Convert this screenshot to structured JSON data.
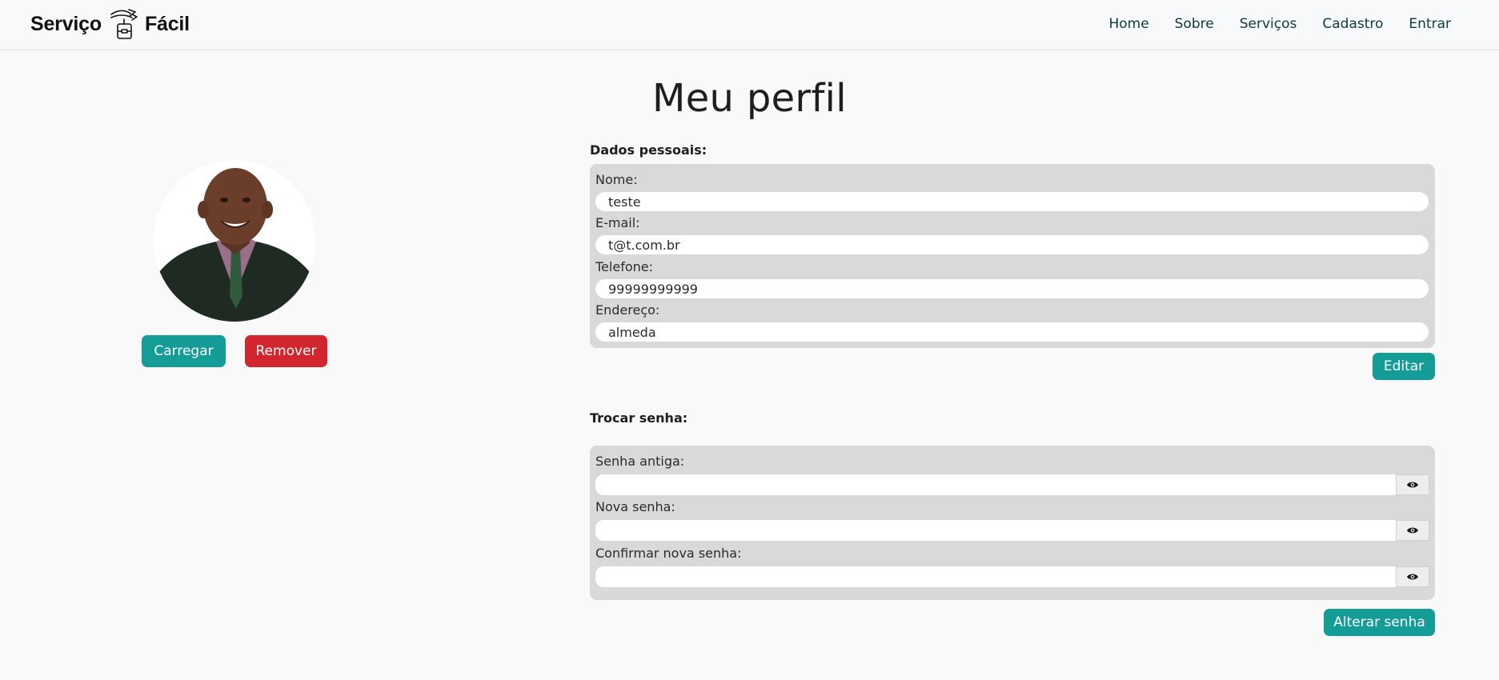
{
  "brand": {
    "name_left": "Serviço",
    "name_right": "Fácil"
  },
  "nav": {
    "links": [
      "Home",
      "Sobre",
      "Serviços",
      "Cadastro",
      "Entrar"
    ]
  },
  "profile": {
    "title": "Meu perfil",
    "upload_label": "Carregar",
    "remove_label": "Remover"
  },
  "personal": {
    "section_label": "Dados pessoais:",
    "fields": [
      {
        "label": "Nome:",
        "value": "teste"
      },
      {
        "label": "E-mail:",
        "value": "t@t.com.br"
      },
      {
        "label": "Telefone:",
        "value": "99999999999"
      },
      {
        "label": "Endereço:",
        "value": "almeda"
      }
    ],
    "edit_label": "Editar"
  },
  "password": {
    "section_label": "Trocar senha:",
    "fields": [
      {
        "label": "Senha antiga:",
        "value": ""
      },
      {
        "label": "Nova senha:",
        "value": ""
      },
      {
        "label": "Confirmar nova senha:",
        "value": ""
      }
    ],
    "submit_label": "Alterar senha"
  },
  "icons": {
    "logo": "sign-box-logo-icon",
    "toggle": "eye-icon"
  },
  "colors": {
    "accent": "#149c97",
    "danger": "#d2262e",
    "panel": "#d9d9d9",
    "nav_text": "#0b3b3a"
  }
}
